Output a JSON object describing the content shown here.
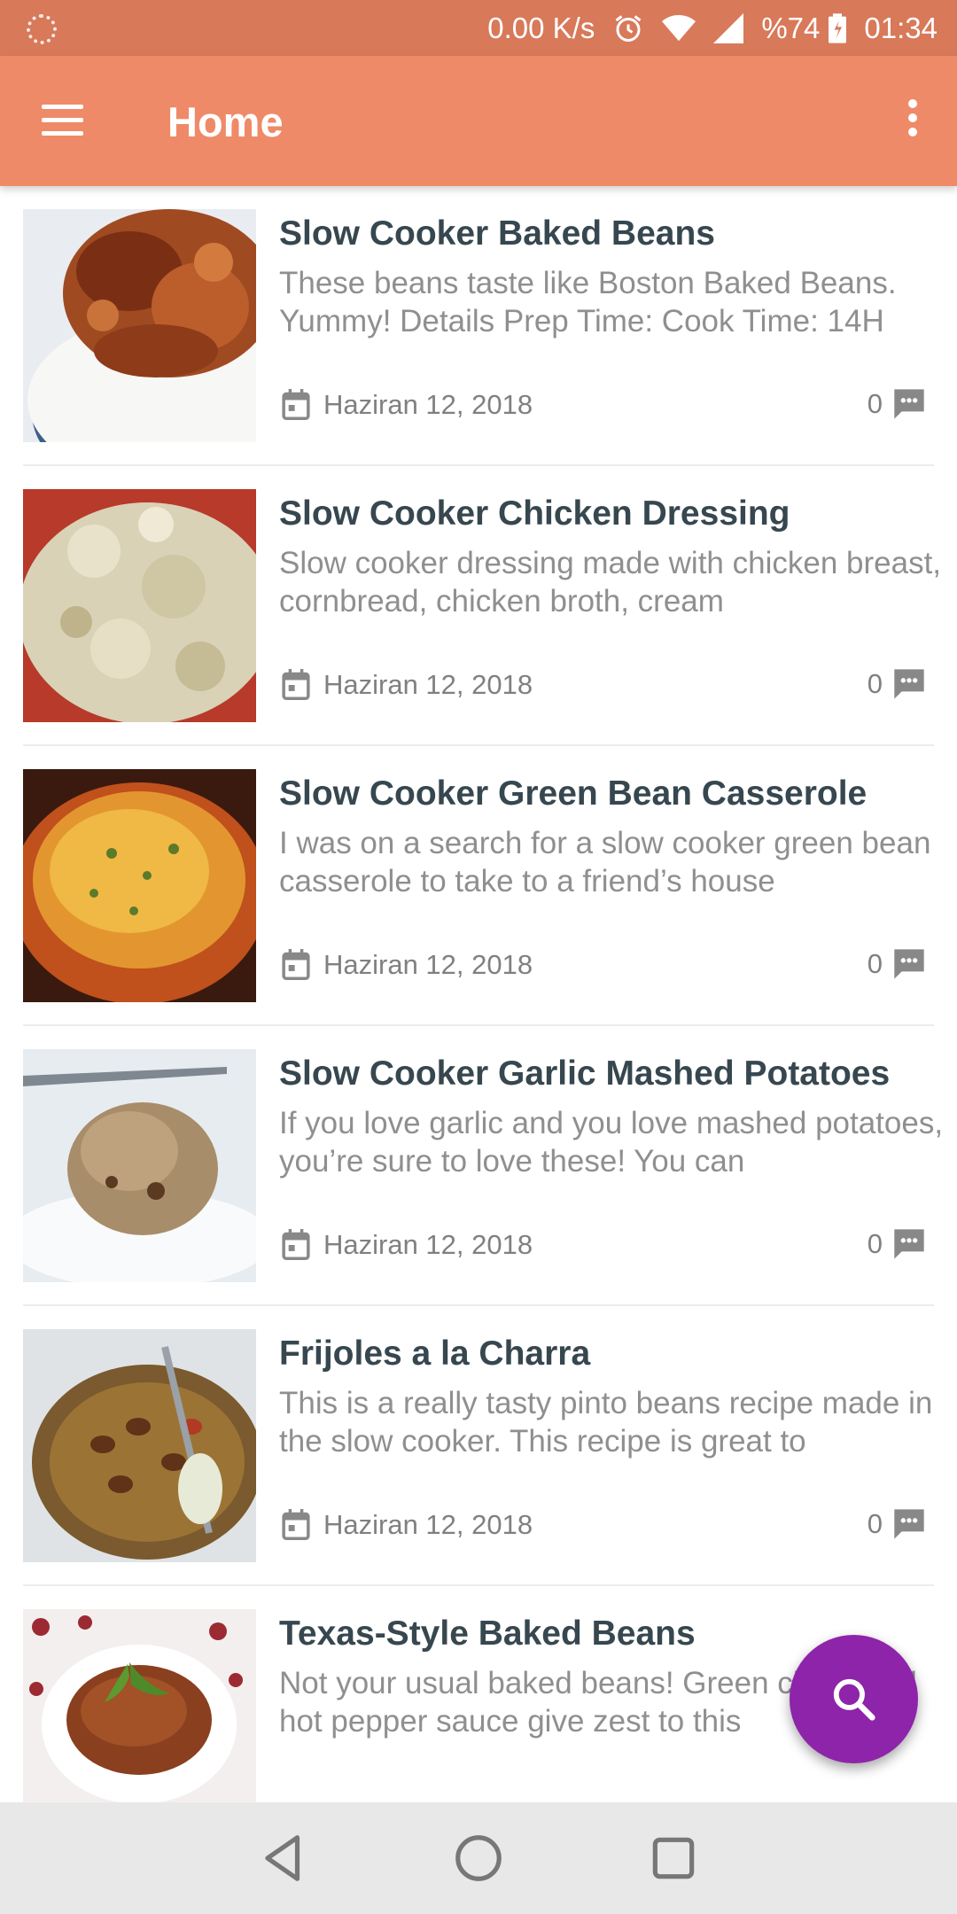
{
  "status_bar": {
    "speed": "0.00 K/s",
    "battery": "%74",
    "time": "01:34",
    "icons": [
      "notification-dot-icon",
      "alarm-icon",
      "wifi-icon",
      "signal-icon",
      "battery-icon"
    ]
  },
  "app_bar": {
    "title": "Home",
    "color": "#ef8a68"
  },
  "posts": [
    {
      "title": "Slow Cooker Baked Beans",
      "excerpt": "These beans taste like Boston Baked Beans. Yummy! Details Prep Time: Cook Time: 14H",
      "date": "Haziran 12, 2018",
      "comments": "0",
      "thumb": "baked-beans-photo"
    },
    {
      "title": "Slow Cooker Chicken Dressing",
      "excerpt": "Slow cooker dressing made with chicken breast, cornbread, chicken broth, cream",
      "date": "Haziran 12, 2018",
      "comments": "0",
      "thumb": "chicken-dressing-photo"
    },
    {
      "title": "Slow Cooker Green Bean Casserole",
      "excerpt": "I was on a search for a slow cooker green bean casserole to take to a friend’s house",
      "date": "Haziran 12, 2018",
      "comments": "0",
      "thumb": "green-bean-casserole-photo"
    },
    {
      "title": "Slow Cooker Garlic Mashed Potatoes",
      "excerpt": "If you love garlic and you love mashed potatoes, you’re sure to love these! You can",
      "date": "Haziran 12, 2018",
      "comments": "0",
      "thumb": "mashed-potatoes-photo"
    },
    {
      "title": "Frijoles a la Charra",
      "excerpt": "This is a really tasty pinto beans recipe made in the slow cooker. This recipe is great to",
      "date": "Haziran 12, 2018",
      "comments": "0",
      "thumb": "frijoles-photo"
    },
    {
      "title": "Texas-Style Baked Beans",
      "excerpt": "Not your usual baked beans! Green chiles and hot pepper sauce give zest to this",
      "date": "",
      "comments": "",
      "thumb": "texas-baked-beans-photo"
    }
  ],
  "fab": {
    "icon": "search-icon",
    "color": "#8e24aa"
  },
  "nav_bar": {
    "icons": [
      "back-icon",
      "home-icon",
      "recents-icon"
    ]
  }
}
